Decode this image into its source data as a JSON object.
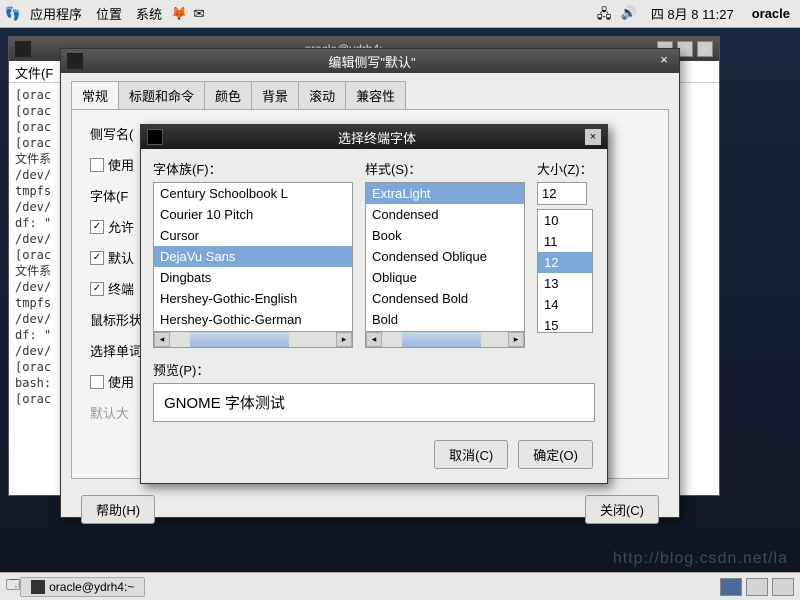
{
  "panel": {
    "apps": "应用程序",
    "places": "位置",
    "system": "系统",
    "date": "四 8月  8 11:27",
    "user": "oracle"
  },
  "terminal": {
    "title": "oracle@ydrh4:~",
    "menu_file": "文件(F",
    "lines": "[orac\n[orac\n[orac\n[orac\n文件系\n/dev/\ntmpfs\n/dev/\ndf: \"\n/dev/\n[orac\n文件系\n/dev/\ntmpfs\n/dev/\ndf: \"\n/dev/\n[orac\nbash:\n[orac"
  },
  "dlg1": {
    "title": "编辑侧写\"默认\"",
    "tabs": [
      "常规",
      "标题和命令",
      "颜色",
      "背景",
      "滚动",
      "兼容性"
    ],
    "profile_name_label": "侧写名(",
    "use_system_font": "使用",
    "font_label": "字体(F",
    "allow_bold": "允许",
    "default_show": "默认",
    "terminal_bell": "终端",
    "cursor_shape": "鼠标形状",
    "select_by_word": "选择单词",
    "use_custom_default": "使用",
    "default_size_hint": "默认大",
    "help": "帮助(H)",
    "close": "关闭(C)"
  },
  "dlg2": {
    "title": "选择终端字体",
    "family_label": "字体族(F)：",
    "style_label": "样式(S)：",
    "size_label": "大小(Z)：",
    "families": [
      "Century Schoolbook L",
      "Courier 10 Pitch",
      "Cursor",
      "DejaVu Sans",
      "Dingbats",
      "Hershey-Gothic-English",
      "Hershey-Gothic-German"
    ],
    "family_selected": "DejaVu Sans",
    "styles": [
      "ExtraLight",
      "Condensed",
      "Book",
      "Condensed Oblique",
      "Oblique",
      "Condensed Bold",
      "Bold"
    ],
    "style_selected": "ExtraLight",
    "sizes": [
      "10",
      "11",
      "12",
      "13",
      "14",
      "15"
    ],
    "size_value": "12",
    "size_selected": "12",
    "preview_label": "预览(P)：",
    "preview_text": "GNOME 字体测试",
    "cancel": "取消(C)",
    "ok": "确定(O)"
  },
  "taskbar": {
    "task1": "oracle@ydrh4:~"
  },
  "watermark": "http://blog.csdn.net/la"
}
